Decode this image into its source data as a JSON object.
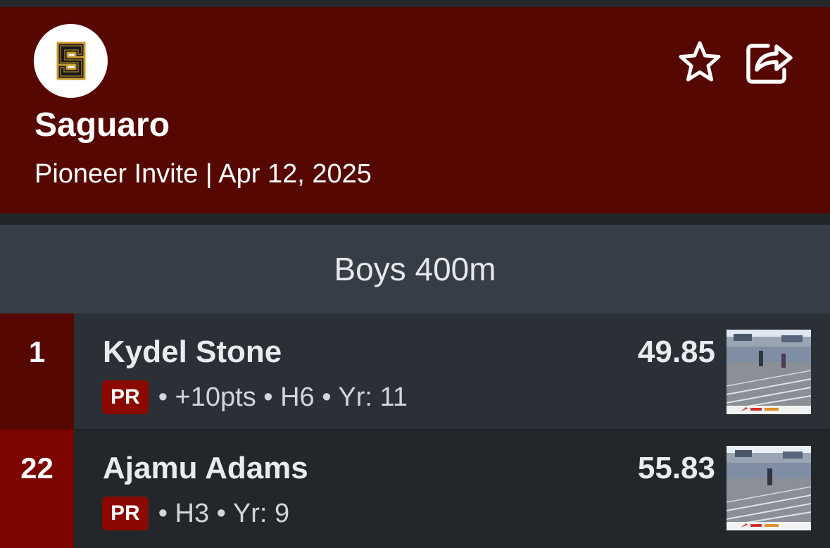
{
  "header": {
    "team_name": "Saguaro",
    "meet_line": "Pioneer Invite | Apr 12, 2025",
    "logo_letter": "S",
    "favorite_icon": "star-outline-icon",
    "share_icon": "share-icon"
  },
  "event": {
    "title": "Boys 400m"
  },
  "results": [
    {
      "place": "1",
      "athlete": "Kydel Stone",
      "badge": "PR",
      "details": "• +10pts • H6 • Yr: 11",
      "mark": "49.85"
    },
    {
      "place": "22",
      "athlete": "Ajamu Adams",
      "badge": "PR",
      "details": "• H3 • Yr: 9",
      "mark": "55.83"
    }
  ],
  "colors": {
    "header_bg": "#570701",
    "event_bar_bg": "#363d46",
    "row_bg": "#2b3036",
    "place_first_bg": "#570701",
    "place_other_bg": "#7c0500",
    "badge_bg": "#8a0a02",
    "logo_gold": "#c79a2a"
  }
}
